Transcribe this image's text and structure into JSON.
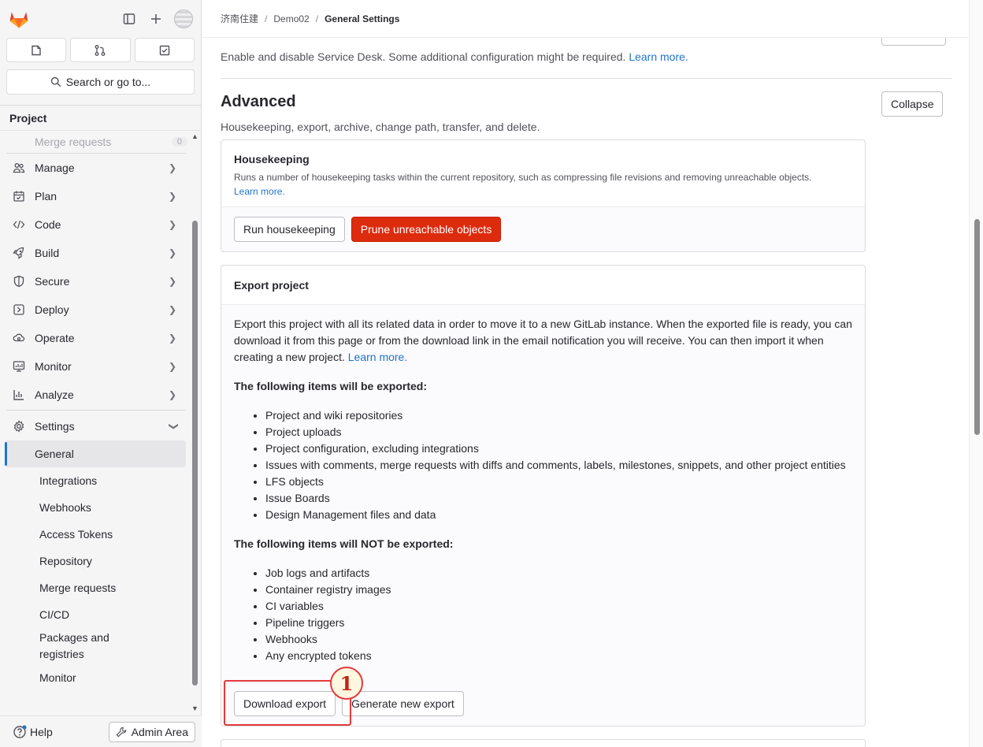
{
  "sidebar": {
    "search_placeholder": "Search or go to...",
    "context_title": "Project",
    "faded_item": "Merge requests",
    "faded_count": "0",
    "nav": [
      {
        "label": "Manage"
      },
      {
        "label": "Plan"
      },
      {
        "label": "Code"
      },
      {
        "label": "Build"
      },
      {
        "label": "Secure"
      },
      {
        "label": "Deploy"
      },
      {
        "label": "Operate"
      },
      {
        "label": "Monitor"
      },
      {
        "label": "Analyze"
      }
    ],
    "settings_label": "Settings",
    "settings_sub": [
      "General",
      "Integrations",
      "Webhooks",
      "Access Tokens",
      "Repository",
      "Merge requests",
      "CI/CD",
      "Packages and registries",
      "Monitor"
    ],
    "help_label": "Help",
    "admin_label": "Admin Area"
  },
  "breadcrumb": [
    "济南住建",
    "Demo02",
    "General Settings"
  ],
  "service_desk": {
    "text": "Enable and disable Service Desk. Some additional configuration might be required.",
    "link": "Learn more."
  },
  "advanced": {
    "title": "Advanced",
    "description": "Housekeeping, export, archive, change path, transfer, and delete.",
    "collapse_label": "Collapse"
  },
  "housekeeping": {
    "title": "Housekeeping",
    "text": "Runs a number of housekeeping tasks within the current repository, such as compressing file revisions and removing unreachable objects.",
    "link": "Learn more.",
    "run_label": "Run housekeeping",
    "prune_label": "Prune unreachable objects"
  },
  "export": {
    "title": "Export project",
    "intro": "Export this project with all its related data in order to move it to a new GitLab instance. When the exported file is ready, you can download it from this page or from the download link in the email notification you will receive. You can then import it when creating a new project.",
    "intro_link": "Learn more.",
    "exported_heading": "The following items will be exported:",
    "exported_items": [
      "Project and wiki repositories",
      "Project uploads",
      "Project configuration, excluding integrations",
      "Issues with comments, merge requests with diffs and comments, labels, milestones, snippets, and other project entities",
      "LFS objects",
      "Issue Boards",
      "Design Management files and data"
    ],
    "not_exported_heading": "The following items will NOT be exported:",
    "not_exported_items": [
      "Job logs and artifacts",
      "Container registry images",
      "CI variables",
      "Pipeline triggers",
      "Webhooks",
      "Any encrypted tokens"
    ],
    "download_label": "Download export",
    "generate_label": "Generate new export"
  },
  "annotation": {
    "number": "1",
    "color": "#e33b3b"
  },
  "colors": {
    "danger": "#dd2b0e",
    "link": "#1f75cb",
    "active_indicator": "#1f75cb"
  }
}
